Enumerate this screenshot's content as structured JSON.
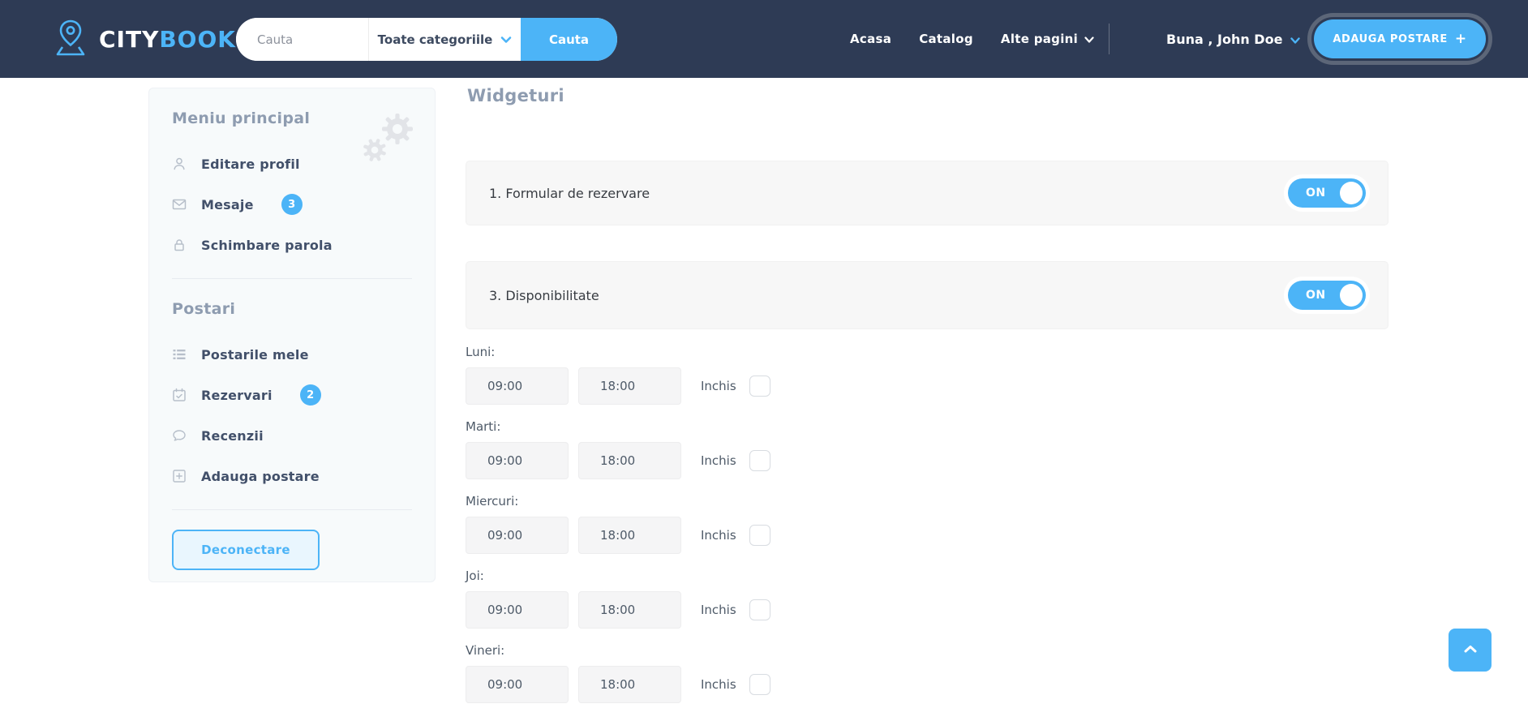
{
  "colors": {
    "navbar": "#2e3b55",
    "accent": "#4cb4f7",
    "sidebar_bg": "#f7fafb",
    "card_bg": "#f7f7f7"
  },
  "brand": {
    "name_primary": "CITY",
    "name_secondary": "BOOK"
  },
  "navbar": {
    "search": {
      "placeholder": "Cauta",
      "category_selected": "Toate categoriile",
      "button_label": "Cauta"
    },
    "links": [
      {
        "label": "Acasa"
      },
      {
        "label": "Catalog"
      },
      {
        "label": "Alte pagini"
      }
    ],
    "greeting": "Buna , John Doe",
    "add_post_label": "ADAUGA POSTARE",
    "add_post_plus": "+"
  },
  "sidebar": {
    "section1_title": "Meniu principal",
    "items1": [
      {
        "label": "Editare profil",
        "icon": "user-icon"
      },
      {
        "label": "Mesaje",
        "icon": "mail-icon",
        "badge": "3"
      },
      {
        "label": "Schimbare parola",
        "icon": "lock-icon"
      }
    ],
    "section2_title": "Postari",
    "items2": [
      {
        "label": "Postarile mele",
        "icon": "list-icon"
      },
      {
        "label": "Rezervari",
        "icon": "calendar-icon",
        "badge": "2"
      },
      {
        "label": "Recenzii",
        "icon": "chat-icon"
      },
      {
        "label": "Adauga postare",
        "icon": "plus-square-icon"
      }
    ],
    "logout_label": "Deconectare"
  },
  "main": {
    "title": "Widgeturi",
    "widgets": [
      {
        "label": "1. Formular de rezervare",
        "state": "ON"
      },
      {
        "label": "3. Disponibilitate",
        "state": "ON"
      }
    ],
    "schedule": {
      "closed_label": "Inchis",
      "days": [
        {
          "label": "Luni:",
          "open": "09:00",
          "close": "18:00"
        },
        {
          "label": "Marti:",
          "open": "09:00",
          "close": "18:00"
        },
        {
          "label": "Miercuri:",
          "open": "09:00",
          "close": "18:00"
        },
        {
          "label": "Joi:",
          "open": "09:00",
          "close": "18:00"
        },
        {
          "label": "Vineri:",
          "open": "09:00",
          "close": "18:00"
        }
      ]
    }
  }
}
